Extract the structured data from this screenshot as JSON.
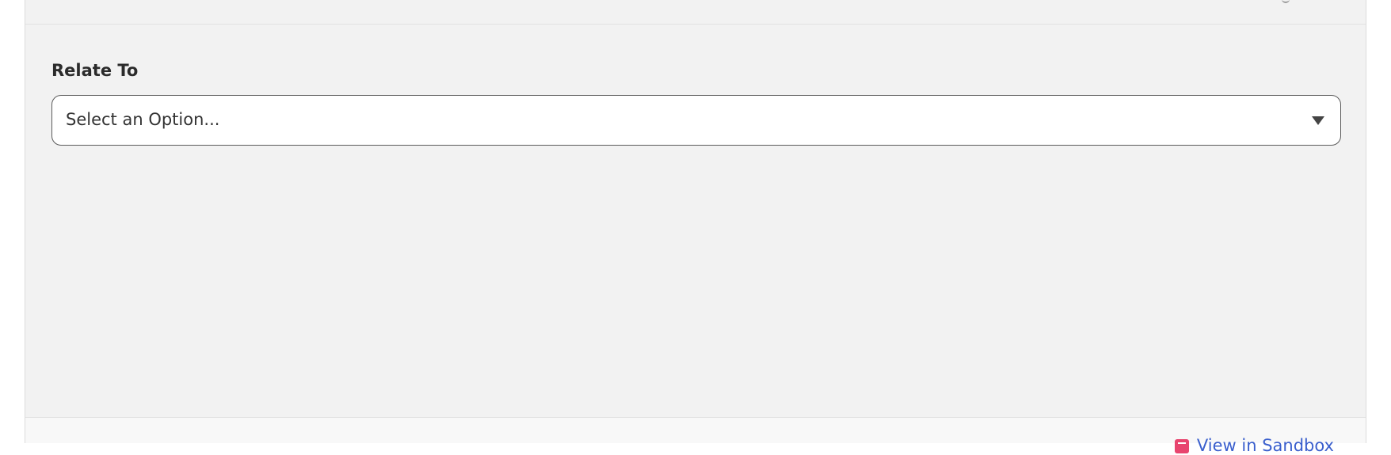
{
  "form": {
    "relate_to": {
      "label": "Relate To",
      "selected_value": "Select an Option..."
    }
  },
  "footer": {
    "link_label": "View in Sandbox",
    "link_color": "#3a5fcd",
    "icon_color": "#e8456f"
  }
}
